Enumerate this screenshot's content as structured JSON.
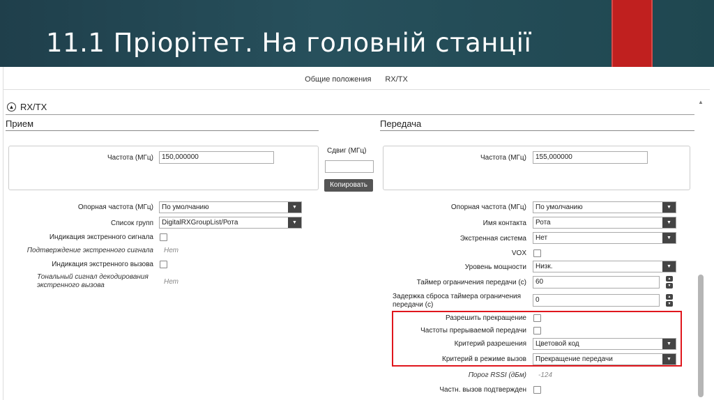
{
  "slide": {
    "title": "11.1 Пріорітет. На головній станції"
  },
  "top_tabs": [
    "Общие положения",
    "RX/TX"
  ],
  "section": {
    "title": "RX/TX"
  },
  "rx": {
    "header": "Прием",
    "freq_label": "Частота (МГц)",
    "freq_value": "150,000000",
    "ref_freq_label": "Опорная частота (МГц)",
    "ref_freq_value": "По умолчанию",
    "group_list_label": "Список групп",
    "group_list_value": "DigitalRXGroupList/Рота",
    "emerg_ind_label": "Индикация экстренного сигнала",
    "emerg_confirm_label": "Подтверждение экстренного сигнала",
    "emerg_confirm_value": "Нет",
    "emerg_call_ind_label": "Индикация экстренного вызова",
    "tone_decode_label_1": "Тональный сигнал декодирования",
    "tone_decode_label_2": "экстренного вызова",
    "tone_decode_value": "Нет"
  },
  "shift": {
    "label": "Сдвиг (МГц)",
    "value": "",
    "copy_button": "Копировать"
  },
  "tx": {
    "header": "Передача",
    "freq_label": "Частота (МГц)",
    "freq_value": "155,000000",
    "ref_freq_label": "Опорная частота (МГц)",
    "ref_freq_value": "По умолчанию",
    "contact_label": "Имя контакта",
    "contact_value": "Рота",
    "emerg_sys_label": "Экстренная система",
    "emerg_sys_value": "Нет",
    "vox_label": "VOX",
    "power_label": "Уровень мощности",
    "power_value": "Низк.",
    "tot_label": "Таймер ограничения передачи (с)",
    "tot_value": "60",
    "tot_reset_label_1": "Задержка сброса таймера ограничения",
    "tot_reset_label_2": "передачи (с)",
    "tot_reset_value": "0",
    "allow_interrupt_label": "Разрешить прекращение",
    "interrupt_freq_label": "Частоты прерываемой передачи",
    "permit_criteria_label": "Критерий разрешения",
    "permit_criteria_value": "Цветовой код",
    "call_mode_criteria_label": "Критерий в режиме вызов",
    "call_mode_criteria_value": "Прекращение передачи",
    "rssi_label": "Порог RSSI (дБм)",
    "rssi_value": "-124",
    "call_confirm_label": "Частн. вызов подтвержден"
  },
  "colors": {
    "header_bg": "#27505c",
    "accent_red": "#c0201f",
    "highlight": "#e0161c",
    "dropdown": "#444444"
  }
}
